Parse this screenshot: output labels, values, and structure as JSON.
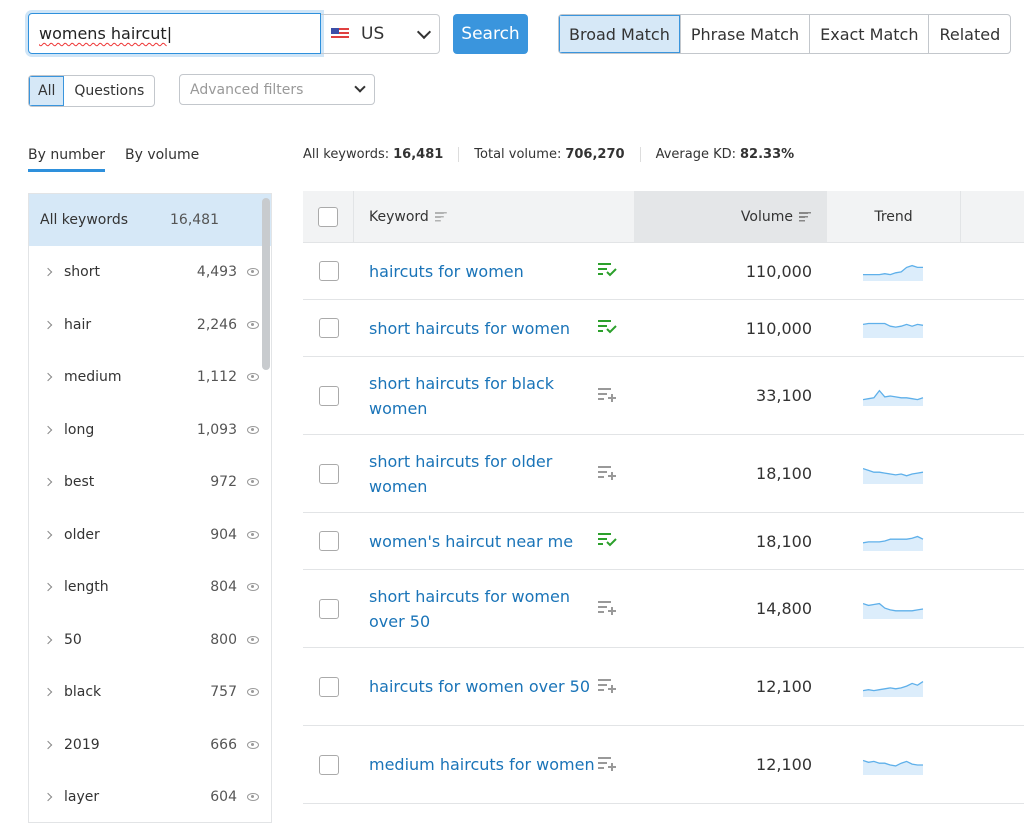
{
  "search": {
    "value": "womens haircut",
    "database": "US",
    "button": "Search"
  },
  "match_types": [
    "Broad Match",
    "Phrase Match",
    "Exact Match",
    "Related"
  ],
  "filter_tabs": [
    "All",
    "Questions"
  ],
  "advanced_filters_placeholder": "Advanced filters",
  "group_tabs": [
    "By number",
    "By volume"
  ],
  "stats": {
    "all_label": "All keywords:",
    "all_value": "16,481",
    "volume_label": "Total volume:",
    "volume_value": "706,270",
    "kd_label": "Average KD:",
    "kd_value": "82.33%"
  },
  "sidebar": {
    "all_label": "All keywords",
    "all_count": "16,481",
    "groups": [
      {
        "label": "short",
        "count": "4,493"
      },
      {
        "label": "hair",
        "count": "2,246"
      },
      {
        "label": "medium",
        "count": "1,112"
      },
      {
        "label": "long",
        "count": "1,093"
      },
      {
        "label": "best",
        "count": "972"
      },
      {
        "label": "older",
        "count": "904"
      },
      {
        "label": "length",
        "count": "804"
      },
      {
        "label": "50",
        "count": "800"
      },
      {
        "label": "black",
        "count": "757"
      },
      {
        "label": "2019",
        "count": "666"
      },
      {
        "label": "layer",
        "count": "604"
      }
    ]
  },
  "table": {
    "columns": [
      "Keyword",
      "Volume",
      "Trend"
    ],
    "rows": [
      {
        "keyword": "haircuts for women",
        "volume": "110,000",
        "added": true,
        "trend": [
          0.3,
          0.3,
          0.3,
          0.3,
          0.35,
          0.3,
          0.4,
          0.45,
          0.7,
          0.8,
          0.7,
          0.7
        ]
      },
      {
        "keyword": "short haircuts for women",
        "volume": "110,000",
        "added": true,
        "trend": [
          0.7,
          0.75,
          0.75,
          0.75,
          0.75,
          0.6,
          0.55,
          0.6,
          0.7,
          0.6,
          0.7,
          0.65
        ]
      },
      {
        "keyword": "short haircuts for black women",
        "volume": "33,100",
        "added": false,
        "trend": [
          0.3,
          0.35,
          0.4,
          0.8,
          0.45,
          0.5,
          0.45,
          0.4,
          0.4,
          0.35,
          0.3,
          0.4
        ]
      },
      {
        "keyword": "short haircuts for older women",
        "volume": "18,100",
        "added": false,
        "trend": [
          0.8,
          0.7,
          0.6,
          0.6,
          0.55,
          0.5,
          0.45,
          0.5,
          0.4,
          0.5,
          0.55,
          0.6
        ]
      },
      {
        "keyword": "women's haircut near me",
        "volume": "18,100",
        "added": true,
        "trend": [
          0.4,
          0.45,
          0.45,
          0.45,
          0.5,
          0.6,
          0.6,
          0.6,
          0.6,
          0.65,
          0.75,
          0.6
        ]
      },
      {
        "keyword": "short haircuts for women over 50",
        "volume": "14,800",
        "added": false,
        "trend": [
          0.8,
          0.7,
          0.75,
          0.8,
          0.55,
          0.45,
          0.4,
          0.4,
          0.4,
          0.4,
          0.45,
          0.5
        ]
      },
      {
        "keyword": "haircuts for women over 50",
        "volume": "12,100",
        "added": false,
        "trend": [
          0.3,
          0.35,
          0.3,
          0.35,
          0.4,
          0.45,
          0.4,
          0.45,
          0.55,
          0.7,
          0.6,
          0.8
        ]
      },
      {
        "keyword": "medium haircuts for women",
        "volume": "12,100",
        "added": false,
        "trend": [
          0.75,
          0.65,
          0.7,
          0.6,
          0.6,
          0.5,
          0.45,
          0.6,
          0.7,
          0.55,
          0.5,
          0.5
        ]
      }
    ]
  },
  "colors": {
    "accent": "#3a95dd",
    "link": "#1a74b8",
    "added": "#2ca02c",
    "trend": "#5fb0ea"
  }
}
